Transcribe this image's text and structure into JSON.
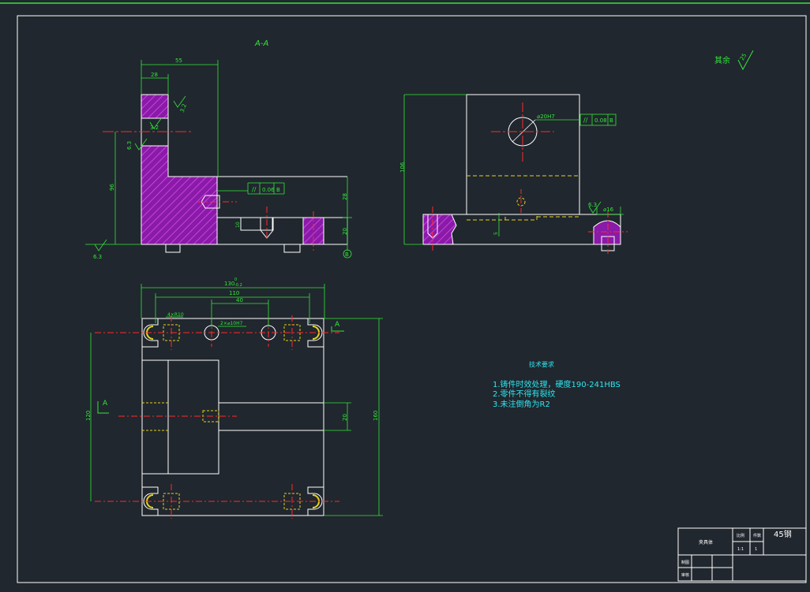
{
  "section_label": "A-A",
  "roughness_note": {
    "label": "其余",
    "value": "25"
  },
  "view_a_label": "A",
  "dims": {
    "d_55": "55",
    "d_28": "28",
    "d_96": "96",
    "d_28b": "28",
    "d_20": "20",
    "d_130": "130",
    "d_130_tol_up": "0",
    "d_130_tol_dn": "-0.2",
    "d_110": "110",
    "d_40": "40",
    "d_120": "120",
    "d_160": "160",
    "d_20b": "20",
    "d_106": "106",
    "d_16": "16",
    "d_10": "10",
    "d_5": "5"
  },
  "callouts": {
    "bore": "⌀20H7",
    "holes": "2×⌀10H7",
    "slots": "4×R10",
    "counterbore": "⌀16"
  },
  "gdt": [
    {
      "symbol": "//",
      "tolerance": "0.06",
      "datum": "B"
    },
    {
      "symbol": "//",
      "tolerance": "0.08",
      "datum": "B"
    }
  ],
  "datum_b": "B",
  "roughness": [
    "6.3",
    "6.3",
    "3.2",
    "3.2",
    "6.3"
  ],
  "tech_req": {
    "title": "技术要求",
    "items": [
      "1.铸件时效处理，硬度190-241HBS",
      "2.零件不得有裂纹",
      "3.未注倒角为R2"
    ]
  },
  "title_block": {
    "part_name": "夹具体",
    "material": "45钢",
    "scale_label": "比例",
    "count_label": "件数",
    "scale": "1:1",
    "count": "1",
    "drawn": "制图",
    "checked": "审核"
  },
  "colors": {
    "background": "#20272e",
    "outline": "#ffffff",
    "dimension": "#33e63a",
    "centerline": "#ff2a2a",
    "hatch": "#a020c0",
    "hidden": "#e6d21e",
    "note_text": "#2ee6f0"
  }
}
